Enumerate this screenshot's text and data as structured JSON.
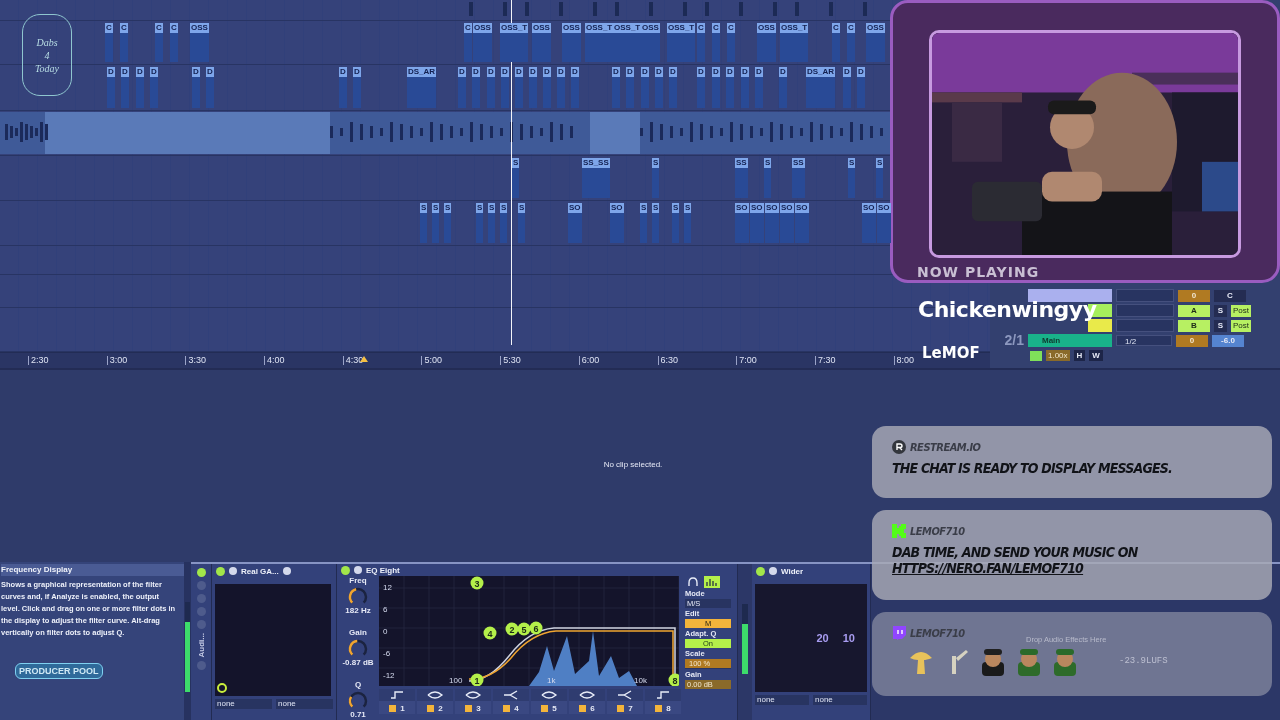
{
  "overlay_logo": {
    "lines": [
      "Dabs",
      "4",
      "Today"
    ]
  },
  "arrangement": {
    "tracks": [
      {
        "kind": "stubs"
      },
      {
        "kind": "clips",
        "clips": [
          "C",
          "C",
          "C",
          "C",
          "OSS",
          "C",
          "OSS",
          "OSS_T",
          "OSS",
          "OSS",
          "OSS_T",
          "OSS_T",
          "OSS",
          "OSS_T",
          "C",
          "C",
          "C",
          "OSS",
          "OSS_T",
          "C",
          "C",
          "OSS"
        ]
      },
      {
        "kind": "clips",
        "clips": [
          "D",
          "D",
          "D",
          "D",
          "D",
          "D",
          "D",
          "D",
          "DS_AR",
          "D",
          "D",
          "D",
          "D",
          "D",
          "D",
          "D",
          "D",
          "D",
          "D",
          "D",
          "D",
          "D",
          "D",
          "D",
          "D",
          "D",
          "D",
          "D",
          "D",
          "DS_AR",
          "D",
          "D"
        ]
      },
      {
        "kind": "audio"
      },
      {
        "kind": "clips",
        "clips": [
          "S",
          "SS_SS",
          "S",
          "SS",
          "S",
          "SS",
          "S",
          "S"
        ]
      },
      {
        "kind": "clips",
        "clips": [
          "S",
          "S",
          "S",
          "S",
          "S",
          "S",
          "S",
          "SO",
          "SO",
          "S",
          "S",
          "S",
          "S",
          "SO",
          "SO",
          "SO",
          "SO",
          "SO",
          "SO",
          "SO"
        ]
      },
      {
        "kind": "empty"
      },
      {
        "kind": "empty"
      },
      {
        "kind": "empty"
      }
    ],
    "ruler": [
      "2:30",
      "3:00",
      "3:30",
      "4:00",
      "4:30",
      "5:00",
      "5:30",
      "6:00",
      "6:30",
      "7:00",
      "7:30",
      "8:00"
    ]
  },
  "mixer": {
    "top_row": {
      "color": "#aab0ee",
      "value": "0",
      "pan": "C"
    },
    "returns": [
      {
        "color": "#a6ee5c",
        "label": "A",
        "solo": "S",
        "post": "Post"
      },
      {
        "color": "#e9ea4a",
        "label": "B",
        "solo": "S",
        "post": "Post"
      }
    ],
    "main": {
      "position": "2/1",
      "color": "#19b28a",
      "name": "Main",
      "routing": "1/2",
      "value": "0",
      "volume": "-6.0"
    },
    "footer": {
      "tempo": "1.00x",
      "buttons": [
        "H",
        "W"
      ]
    }
  },
  "now_playing": {
    "label": "NOW PLAYING",
    "title": "Chickenwingyy",
    "artist": "LeMOF"
  },
  "detail_view": {
    "message": "No clip selected."
  },
  "info_panel": {
    "title": "Frequency Display",
    "text": "Shows a graphical representation of the filter curves and, if Analyze is enabled, the output level. Click and drag on one or more filter dots in the display to adjust the filter curve. Alt-drag vertically on filter dots to adjust Q.",
    "logo": "PRODUCER POOL"
  },
  "rack": {
    "label": "Audi..."
  },
  "real_ga": {
    "title": "Real GA...",
    "inputs": [
      "none",
      "none"
    ]
  },
  "eq": {
    "title": "EQ Eight",
    "knobs": [
      {
        "label": "Freq",
        "value": "182 Hz",
        "level": 0.45
      },
      {
        "label": "Gain",
        "value": "-0.87 dB",
        "level": 0.48
      },
      {
        "label": "Q",
        "value": "0.71",
        "level": 0.28
      }
    ],
    "y_labels": [
      "12",
      "6",
      "0",
      "-6",
      "-12"
    ],
    "x_labels": [
      "100",
      "1k",
      "10k"
    ],
    "dots": [
      "3",
      "4",
      "2",
      "5",
      "6",
      "1",
      "8"
    ],
    "bands": [
      {
        "number": "1",
        "kind": "shelf",
        "on": true
      },
      {
        "number": "2",
        "kind": "bell",
        "on": true
      },
      {
        "number": "3",
        "kind": "bell",
        "on": true
      },
      {
        "number": "4",
        "kind": "cut",
        "on": true
      },
      {
        "number": "5",
        "kind": "bell",
        "on": true
      },
      {
        "number": "6",
        "kind": "bell",
        "on": true
      },
      {
        "number": "7",
        "kind": "cut",
        "on": true
      },
      {
        "number": "8",
        "kind": "shelf",
        "on": true
      }
    ],
    "analyze": true,
    "mode": {
      "label": "Mode",
      "value": "M/S"
    },
    "edit": {
      "label": "Edit",
      "value": "M"
    },
    "adaptive_q": {
      "label": "Adapt. Q",
      "value": "On",
      "on": true
    },
    "scale": {
      "label": "Scale",
      "value": "100 %",
      "level": 1
    },
    "gain": {
      "label": "Gain",
      "value": "0.00 dB"
    }
  },
  "wider": {
    "title": "Wider",
    "values": [
      "20",
      "10"
    ],
    "inputs": [
      "none",
      "none"
    ]
  },
  "drop_hint": "Drop Audio Effects Here",
  "loudness": "-23.9LUFS",
  "chat": [
    {
      "kind": "restream",
      "user": "RESTREAM.IO",
      "text": "THE CHAT IS READY TO DISPLAY MESSAGES."
    },
    {
      "kind": "kick",
      "user": "LEMOF710",
      "text": "DAB TIME, AND SEND YOUR MUSIC ON",
      "link": "HTTPS://NERO.FAN/LEMOF710"
    },
    {
      "kind": "twitch",
      "user": "LEMOF710",
      "emotes": [
        {
          "kind": "mushroom"
        },
        {
          "kind": "pipe"
        },
        {
          "kind": "darkcap"
        },
        {
          "kind": "greencap"
        },
        {
          "kind": "greencap"
        }
      ]
    }
  ]
}
